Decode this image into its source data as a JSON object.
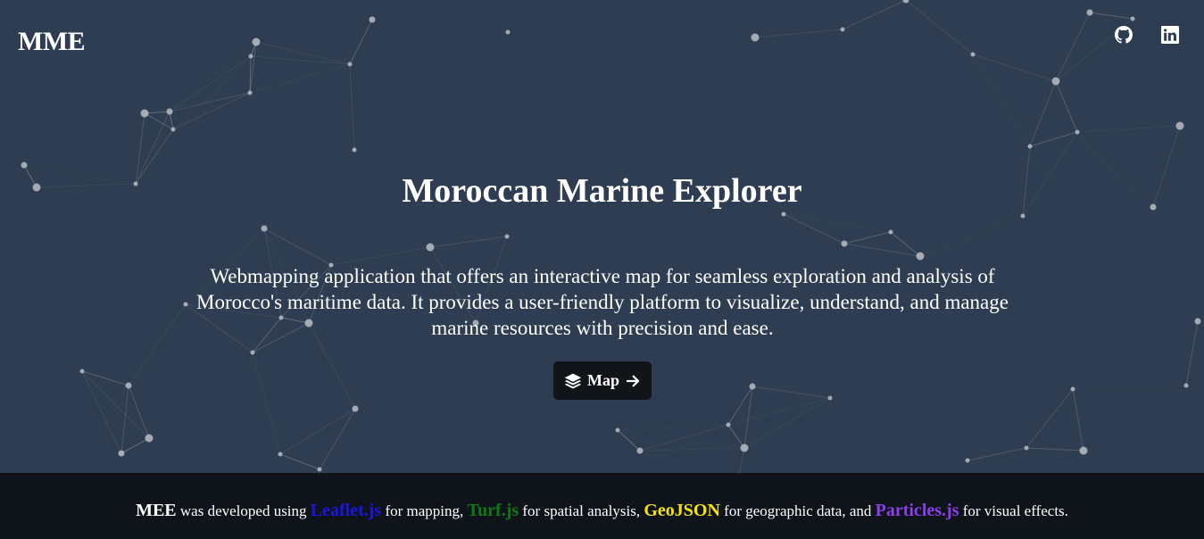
{
  "header": {
    "brand": "MME",
    "links": [
      {
        "icon": "github-icon",
        "label": "GitHub"
      },
      {
        "icon": "linkedin-icon",
        "label": "LinkedIn"
      }
    ]
  },
  "hero": {
    "title": "Moroccan Marine Explorer",
    "description": "Webmapping application that offers an interactive map for seamless exploration and analysis of Morocco's maritime data. It provides a user-friendly platform to visualize, understand, and manage marine resources with precision and ease.",
    "button_label": "Map",
    "button_icon": "layers-icon",
    "button_arrow_icon": "arrow-right-icon"
  },
  "footer": {
    "mee": "MEE",
    "t1": "was developed using",
    "leaflet": "Leaflet.js",
    "t2": "for mapping,",
    "turf": "Turf.js",
    "t3": "for spatial analysis,",
    "geojson": "GeoJSON",
    "t4": "for geographic data, and",
    "particles": "Particles.js",
    "t5": "for visual effects."
  },
  "colors": {
    "background": "#2e3d51",
    "footer": "#0f141a",
    "leaflet": "#1a16e0",
    "turf": "#0f7a12",
    "geojson": "#f5e20a",
    "particles": "#8c3ee8",
    "button": "#111418"
  }
}
